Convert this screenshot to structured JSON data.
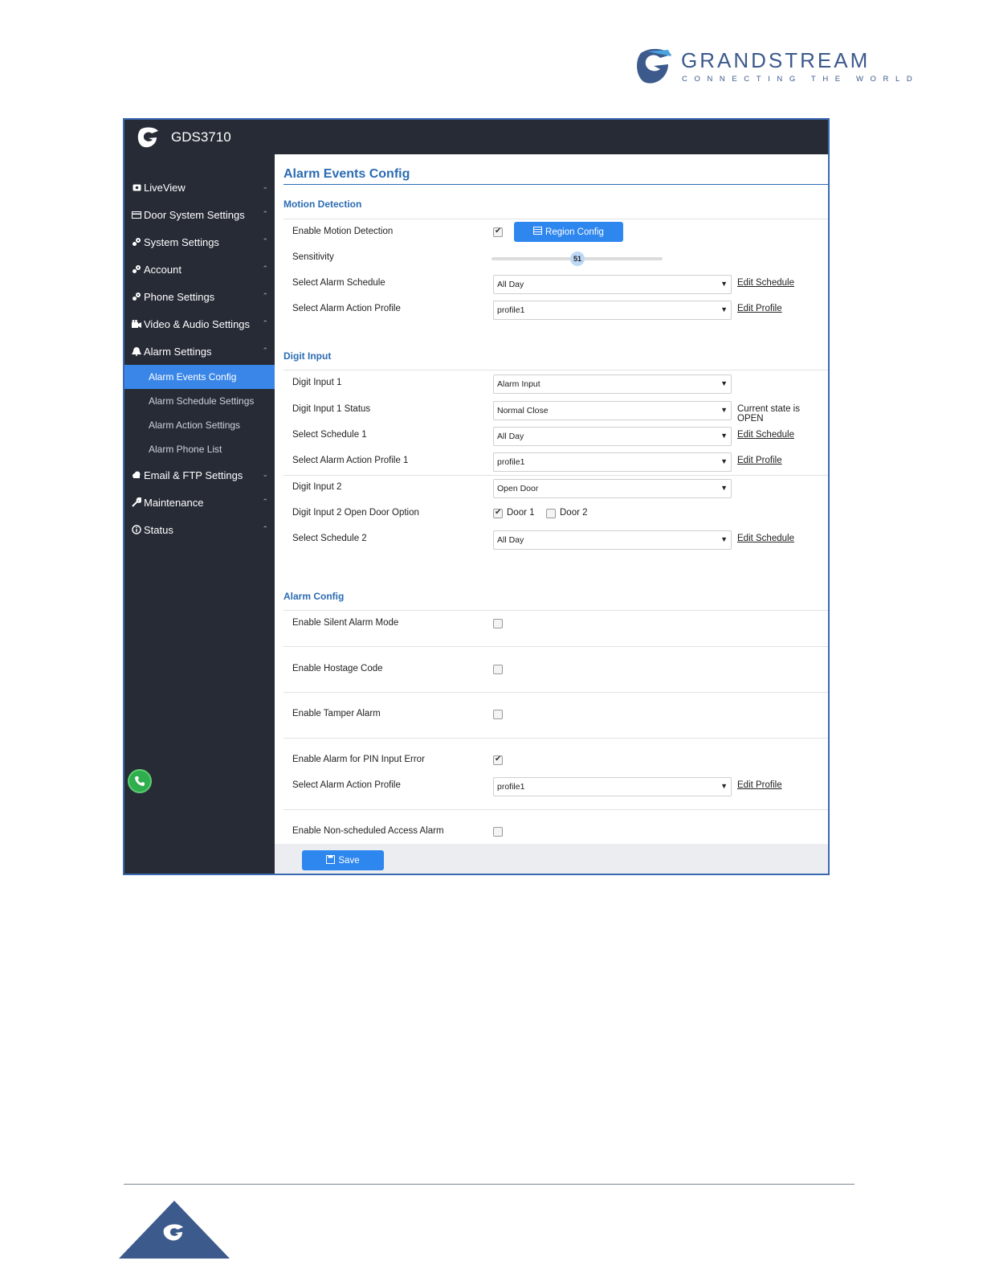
{
  "brand": {
    "name": "GRANDSTREAM",
    "tagline": "CONNECTING THE WORLD"
  },
  "app": {
    "title": "GDS3710"
  },
  "sidebar": {
    "items": [
      {
        "label": "LiveView",
        "icon": "monitor-icon",
        "chevron": "⌄"
      },
      {
        "label": "Door System Settings",
        "icon": "card-icon",
        "chevron": "⌃"
      },
      {
        "label": "System Settings",
        "icon": "gears-icon",
        "chevron": "⌃"
      },
      {
        "label": "Account",
        "icon": "gears-icon",
        "chevron": "⌃"
      },
      {
        "label": "Phone Settings",
        "icon": "gears-icon",
        "chevron": "⌃"
      },
      {
        "label": "Video & Audio Settings",
        "icon": "camera-icon",
        "chevron": "⌃"
      },
      {
        "label": "Alarm Settings",
        "icon": "bell-icon",
        "chevron": "⌃"
      }
    ],
    "subitems": [
      {
        "label": "Alarm Events Config",
        "active": true
      },
      {
        "label": "Alarm Schedule Settings"
      },
      {
        "label": "Alarm Action Settings"
      },
      {
        "label": "Alarm Phone List"
      }
    ],
    "items_after": [
      {
        "label": "Email & FTP Settings",
        "icon": "cloud-icon",
        "chevron": "⌄"
      },
      {
        "label": "Maintenance",
        "icon": "wrench-icon",
        "chevron": "⌃"
      },
      {
        "label": "Status",
        "icon": "info-icon",
        "chevron": "⌃"
      }
    ]
  },
  "main": {
    "title": "Alarm Events Config",
    "motion": {
      "heading": "Motion Detection",
      "enable_label": "Enable Motion Detection",
      "enable_checked": true,
      "region_button": "Region Config",
      "sensitivity_label": "Sensitivity",
      "sensitivity_value": "51",
      "schedule_label": "Select Alarm Schedule",
      "schedule_value": "All Day",
      "edit_schedule": "Edit Schedule",
      "profile_label": "Select Alarm Action Profile",
      "profile_value": "profile1",
      "edit_profile": "Edit Profile"
    },
    "digit": {
      "heading": "Digit Input",
      "input1_label": "Digit Input 1",
      "input1_value": "Alarm Input",
      "status1_label": "Digit Input 1 Status",
      "status1_value": "Normal Close",
      "status1_state": "Current state is OPEN",
      "schedule1_label": "Select Schedule 1",
      "schedule1_value": "All Day",
      "edit_schedule": "Edit Schedule",
      "profile1_label": "Select Alarm Action Profile 1",
      "profile1_value": "profile1",
      "edit_profile": "Edit Profile",
      "input2_label": "Digit Input 2",
      "input2_value": "Open Door",
      "door_option_label": "Digit Input 2 Open Door Option",
      "door1_label": "Door 1",
      "door1_checked": true,
      "door2_label": "Door 2",
      "door2_checked": false,
      "schedule2_label": "Select Schedule 2",
      "schedule2_value": "All Day"
    },
    "alarm": {
      "heading": "Alarm Config",
      "silent_label": "Enable Silent Alarm Mode",
      "hostage_label": "Enable Hostage Code",
      "tamper_label": "Enable Tamper Alarm",
      "pin_label": "Enable Alarm for PIN Input Error",
      "pin_checked": true,
      "pin_profile_label": "Select Alarm Action Profile",
      "pin_profile_value": "profile1",
      "edit_profile": "Edit Profile",
      "nonsched_label": "Enable Non-scheduled Access Alarm"
    },
    "save_label": "Save"
  }
}
